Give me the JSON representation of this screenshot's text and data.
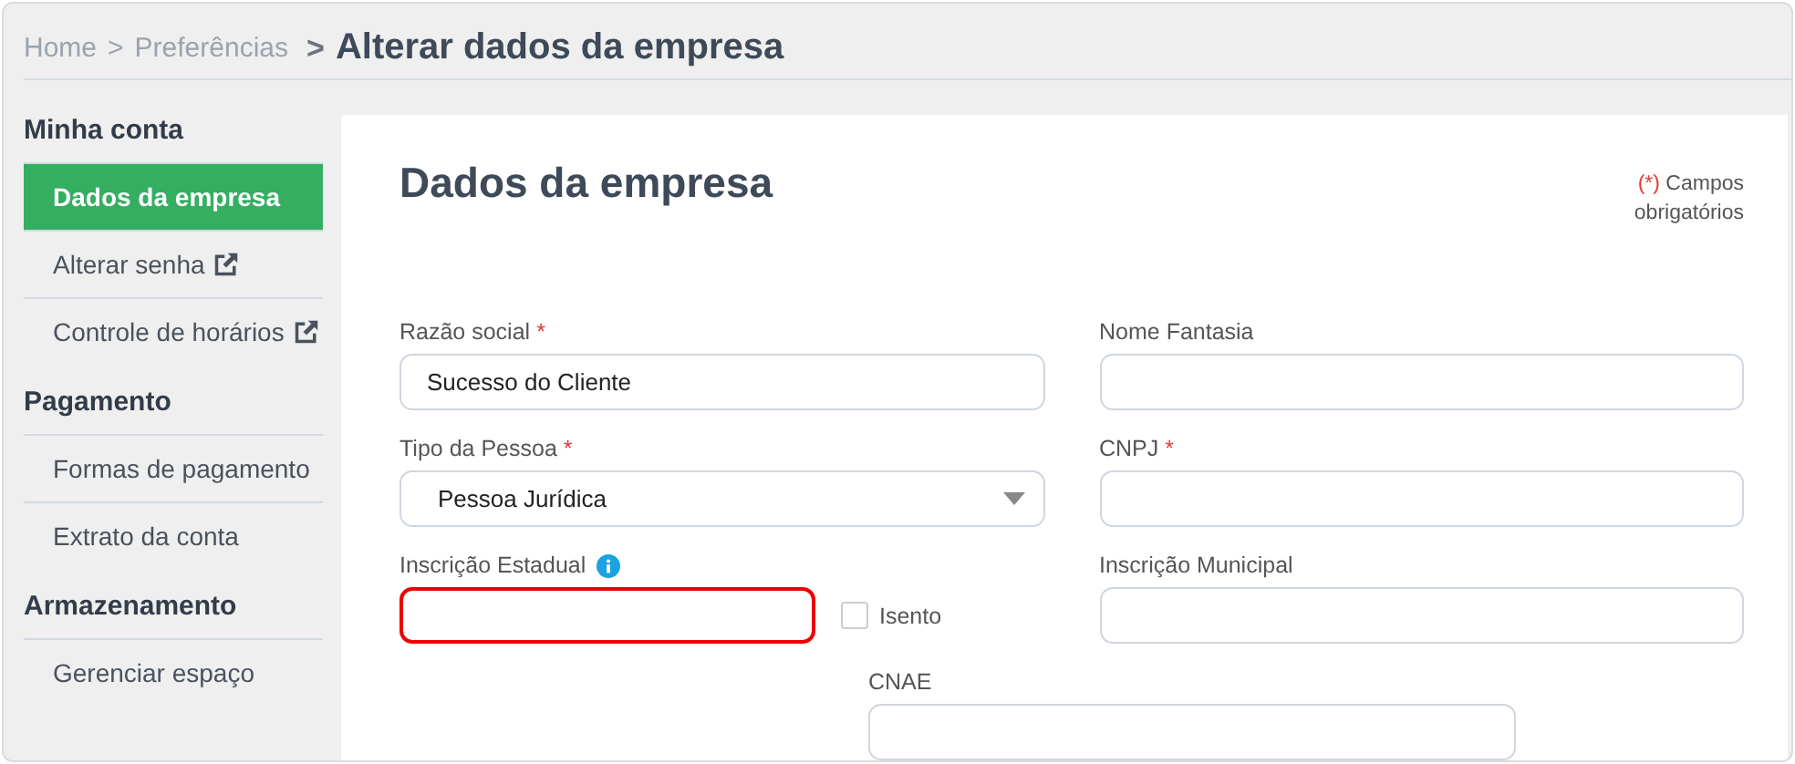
{
  "breadcrumb": {
    "links": [
      "Home",
      "Preferências"
    ],
    "separator": ">",
    "current": "Alterar dados da empresa",
    "current_separator": ">"
  },
  "sidebar": {
    "sections": [
      {
        "title": "Minha conta",
        "items": [
          {
            "label": "Dados da empresa",
            "selected": true,
            "external": false
          },
          {
            "label": "Alterar senha",
            "selected": false,
            "external": true
          },
          {
            "label": "Controle de horários",
            "selected": false,
            "external": true
          }
        ]
      },
      {
        "title": "Pagamento",
        "items": [
          {
            "label": "Formas de pagamento",
            "selected": false,
            "external": false
          },
          {
            "label": "Extrato da conta",
            "selected": false,
            "external": false
          }
        ]
      },
      {
        "title": "Armazenamento",
        "items": [
          {
            "label": "Gerenciar espaço",
            "selected": false,
            "external": false
          }
        ]
      }
    ]
  },
  "panel": {
    "title": "Dados da empresa",
    "required_note": {
      "mark": "(*)",
      "text": "Campos obrigatórios"
    },
    "rows": [
      {
        "fields": [
          {
            "kind": "text",
            "label": "Razão social",
            "required_mark": "*",
            "value": "Sucesso do Cliente",
            "error": false
          },
          {
            "kind": "text",
            "label": "Nome Fantasia",
            "error": false
          }
        ]
      },
      {
        "fields": [
          {
            "kind": "select",
            "label": "Tipo da Pessoa",
            "required_mark": "*",
            "value": "Pessoa Jurídica",
            "error": false
          },
          {
            "kind": "text",
            "label": "CNPJ",
            "required_mark": "*",
            "error": false
          }
        ]
      },
      {
        "fields": [
          {
            "kind": "text_with_checkbox",
            "label": "Inscrição Estadual",
            "info": true,
            "error": true,
            "checkbox": {
              "label": "Isento",
              "checked": false
            }
          },
          {
            "kind": "text",
            "label": "Inscrição Municipal",
            "error": false
          }
        ]
      },
      {
        "fields": [
          {
            "kind": "text",
            "label": "CNAE",
            "error": false
          }
        ]
      }
    ]
  }
}
